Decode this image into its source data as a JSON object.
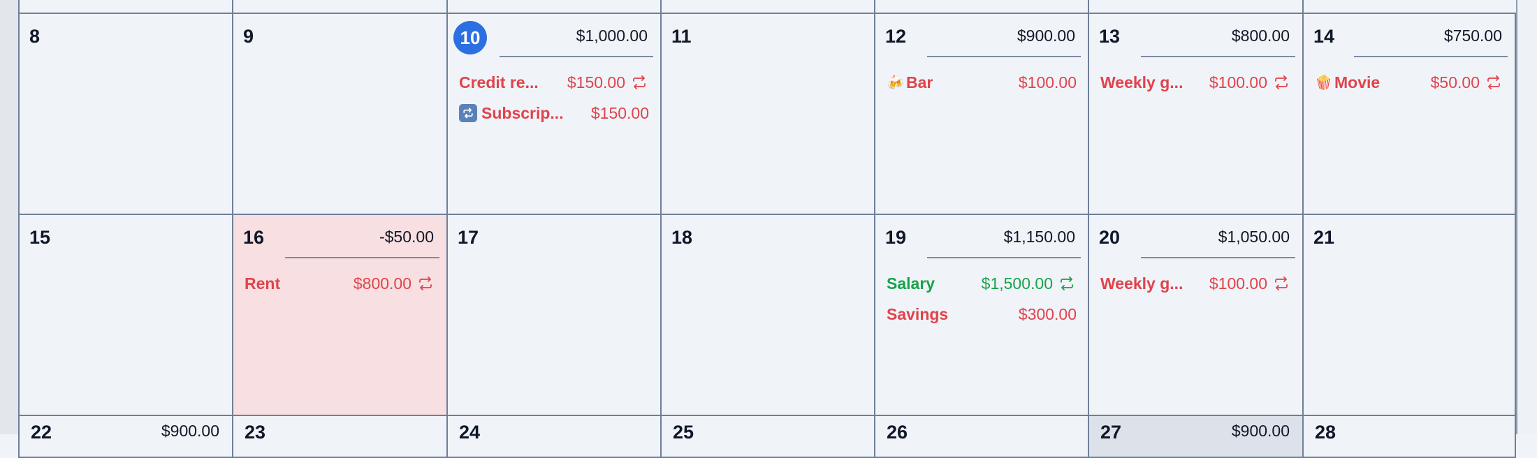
{
  "calendar": {
    "week2": [
      {
        "day": "8"
      },
      {
        "day": "9"
      },
      {
        "day": "10",
        "today": true,
        "balance": "$1,000.00",
        "events": [
          {
            "name": "Credit re...",
            "amount": "$150.00",
            "type": "expense",
            "recurring": true,
            "icon": ""
          },
          {
            "name": "Subscrip...",
            "amount": "$150.00",
            "type": "expense",
            "recurring": false,
            "icon": "repeat-square-icon"
          }
        ]
      },
      {
        "day": "11"
      },
      {
        "day": "12",
        "balance": "$900.00",
        "events": [
          {
            "name": "Bar",
            "amount": "$100.00",
            "type": "expense",
            "recurring": false,
            "icon": "🍻"
          }
        ]
      },
      {
        "day": "13",
        "balance": "$800.00",
        "events": [
          {
            "name": "Weekly g...",
            "amount": "$100.00",
            "type": "expense",
            "recurring": true,
            "icon": ""
          }
        ]
      },
      {
        "day": "14",
        "balance": "$750.00",
        "events": [
          {
            "name": "Movie",
            "amount": "$50.00",
            "type": "expense",
            "recurring": true,
            "icon": "🍿"
          }
        ]
      }
    ],
    "week3": [
      {
        "day": "15"
      },
      {
        "day": "16",
        "balance": "-$50.00",
        "highlight": true,
        "events": [
          {
            "name": "Rent",
            "amount": "$800.00",
            "type": "expense",
            "recurring": true,
            "icon": ""
          }
        ]
      },
      {
        "day": "17"
      },
      {
        "day": "18"
      },
      {
        "day": "19",
        "balance": "$1,150.00",
        "events": [
          {
            "name": "Salary",
            "amount": "$1,500.00",
            "type": "income",
            "recurring": true,
            "icon": ""
          },
          {
            "name": "Savings",
            "amount": "$300.00",
            "type": "expense",
            "recurring": false,
            "icon": ""
          }
        ]
      },
      {
        "day": "20",
        "balance": "$1,050.00",
        "events": [
          {
            "name": "Weekly g...",
            "amount": "$100.00",
            "type": "expense",
            "recurring": true,
            "icon": ""
          }
        ]
      },
      {
        "day": "21"
      }
    ],
    "week4_peek": [
      {
        "day": "22",
        "balance": "$900.00"
      },
      {
        "day": "23"
      },
      {
        "day": "24"
      },
      {
        "day": "25"
      },
      {
        "day": "26"
      },
      {
        "day": "27",
        "balance": "$900.00",
        "shaded": true
      },
      {
        "day": "28"
      }
    ]
  },
  "colors": {
    "expense": "#e0434b",
    "income": "#16a34a",
    "today": "#2c6fe2",
    "negative_day_bg": "#f8dfe1",
    "grid_line": "#6f7f99"
  }
}
